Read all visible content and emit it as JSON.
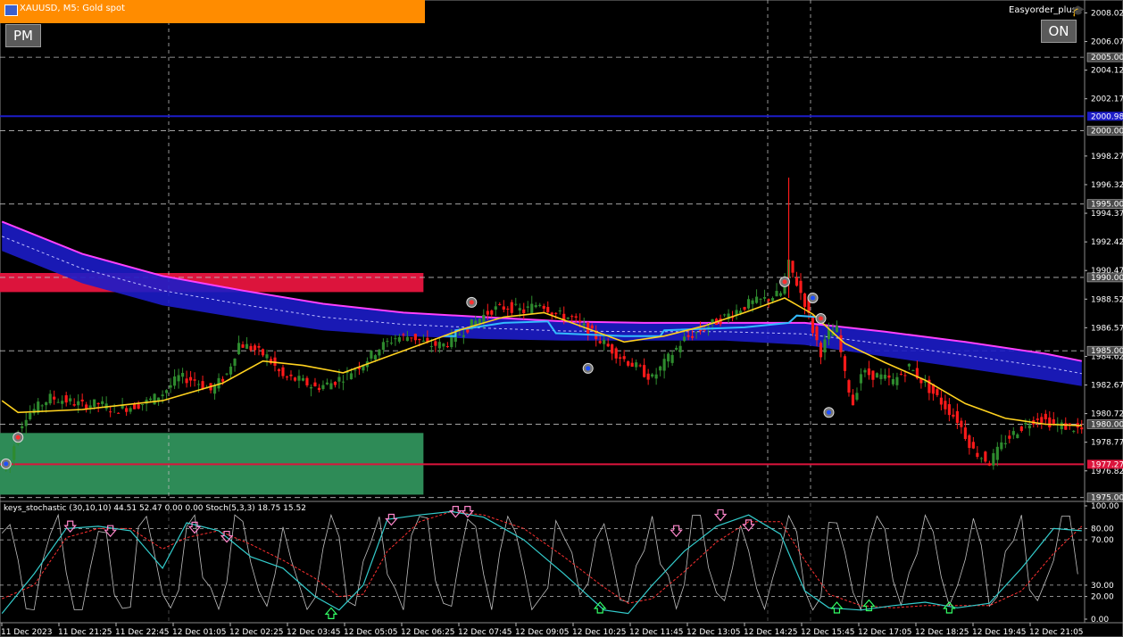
{
  "header": {
    "symbol_label": "XAUUSD, M5:  Gold spot"
  },
  "buttons": {
    "pm": "PM",
    "on": "ON"
  },
  "expert": {
    "name": "Easyorder_plus",
    "icon": "graduation-cap-icon"
  },
  "indicator": {
    "label": "keys_stochastic (30,10,10) 44.51 52.47 0.00 0.00 Stoch(5,3,3) 18.75 15.52"
  },
  "colors": {
    "background": "#000000",
    "bull": "#2e8b2e",
    "bear": "#ff1a1a",
    "ma_yellow": "#ffd21f",
    "band_magenta": "#ff40ff",
    "band_blue": "#1c1cc8",
    "band_cyan": "#33bbff",
    "resistance_zone": "#dc143c",
    "support_zone": "#2e8b57",
    "header": "#ff8c00",
    "stoch_main": "#33cccc",
    "stoch_signal": "#ff3030",
    "stoch_fast": "#bfbfbf"
  },
  "chart_data": [
    {
      "type": "candlestick",
      "title": "XAUUSD, M5:  Gold spot",
      "y_tick_labels": [
        "2008.02",
        "2006.07",
        "2004.12",
        "2002.17",
        "1998.27",
        "1996.32",
        "1994.37",
        "1992.42",
        "1990.47",
        "1988.52",
        "1986.57",
        "1984.62",
        "1982.67",
        "1980.72",
        "1978.77",
        "1976.82"
      ],
      "y_tick_values": [
        2008.02,
        2006.07,
        2004.12,
        2002.17,
        1998.27,
        1996.32,
        1994.37,
        1992.42,
        1990.47,
        1988.52,
        1986.57,
        1984.62,
        1982.67,
        1980.72,
        1978.77,
        1976.82
      ],
      "boxed_levels": [
        {
          "label": "2005.00",
          "value": 2005.0
        },
        {
          "label": "2000.00",
          "value": 2000.0
        },
        {
          "label": "1995.00",
          "value": 1995.0
        },
        {
          "label": "1990.00",
          "value": 1990.0
        },
        {
          "label": "1985.00",
          "value": 1985.0
        },
        {
          "label": "1980.00",
          "value": 1980.0
        },
        {
          "label": "1975.00",
          "value": 1975.0
        }
      ],
      "horizontal_lines": [
        {
          "label": "2000.98",
          "value": 2000.98,
          "color": "#1c1cc8"
        },
        {
          "label": "1977.27",
          "value": 1977.27,
          "color": "#dc143c"
        }
      ],
      "ylim": [
        1974.8,
        2008.9
      ],
      "x_tick_labels": [
        "11 Dec 2023",
        "11 Dec 21:25",
        "11 Dec 22:45",
        "12 Dec 01:05",
        "12 Dec 02:25",
        "12 Dec 03:45",
        "12 Dec 05:05",
        "12 Dec 06:25",
        "12 Dec 07:45",
        "12 Dec 09:05",
        "12 Dec 10:25",
        "12 Dec 11:45",
        "12 Dec 13:05",
        "12 Dec 14:25",
        "12 Dec 15:45",
        "12 Dec 17:05",
        "12 Dec 18:25",
        "12 Dec 19:45",
        "12 Dec 21:05"
      ],
      "close_path": [
        [
          0,
          1976.9
        ],
        [
          2,
          1977.5
        ],
        [
          4,
          1979.6
        ],
        [
          6,
          1980.6
        ],
        [
          8,
          1981.0
        ],
        [
          12,
          1981.8
        ],
        [
          16,
          1981.6
        ],
        [
          20,
          1981.3
        ],
        [
          24,
          1981.4
        ],
        [
          28,
          1981.0
        ],
        [
          32,
          1981.2
        ],
        [
          36,
          1981.5
        ],
        [
          40,
          1982.1
        ],
        [
          44,
          1983.2
        ],
        [
          48,
          1983.0
        ],
        [
          52,
          1982.3
        ],
        [
          56,
          1983.4
        ],
        [
          59,
          1985.5
        ],
        [
          62,
          1985.2
        ],
        [
          66,
          1984.6
        ],
        [
          70,
          1983.2
        ],
        [
          74,
          1983.0
        ],
        [
          78,
          1982.5
        ],
        [
          82,
          1982.8
        ],
        [
          86,
          1983.4
        ],
        [
          90,
          1984.2
        ],
        [
          94,
          1985.2
        ],
        [
          98,
          1985.9
        ],
        [
          102,
          1986.0
        ],
        [
          106,
          1985.4
        ],
        [
          110,
          1985.4
        ],
        [
          114,
          1986.2
        ],
        [
          118,
          1987.0
        ],
        [
          122,
          1987.8
        ],
        [
          126,
          1988.0
        ],
        [
          130,
          1987.7
        ],
        [
          134,
          1988.3
        ],
        [
          138,
          1987.5
        ],
        [
          142,
          1987.2
        ],
        [
          146,
          1986.4
        ],
        [
          150,
          1985.5
        ],
        [
          154,
          1984.6
        ],
        [
          158,
          1983.9
        ],
        [
          162,
          1983.1
        ],
        [
          166,
          1984.5
        ],
        [
          170,
          1985.8
        ],
        [
          174,
          1986.4
        ],
        [
          178,
          1987.0
        ],
        [
          182,
          1987.6
        ],
        [
          186,
          1988.2
        ],
        [
          190,
          1988.5
        ],
        [
          194,
          1988.9
        ],
        [
          196,
          1990.9
        ],
        [
          198,
          1989.6
        ],
        [
          200,
          1988.3
        ],
        [
          202,
          1986.4
        ],
        [
          204,
          1984.9
        ],
        [
          206,
          1986.2
        ],
        [
          208,
          1986.4
        ],
        [
          210,
          1983.3
        ],
        [
          212,
          1981.4
        ],
        [
          214,
          1983.5
        ],
        [
          218,
          1983.3
        ],
        [
          222,
          1982.9
        ],
        [
          226,
          1983.9
        ],
        [
          230,
          1982.7
        ],
        [
          234,
          1981.5
        ],
        [
          238,
          1980.3
        ],
        [
          242,
          1978.2
        ],
        [
          246,
          1977.4
        ],
        [
          250,
          1978.9
        ],
        [
          254,
          1979.8
        ],
        [
          258,
          1980.5
        ],
        [
          262,
          1980.0
        ],
        [
          266,
          1979.8
        ],
        [
          269,
          1979.6
        ]
      ],
      "spike": {
        "bar": 196,
        "high": 1996.8
      },
      "bands": {
        "upper": [
          [
            0,
            1993.8
          ],
          [
            20,
            1991.6
          ],
          [
            40,
            1990.1
          ],
          [
            60,
            1989.1
          ],
          [
            80,
            1988.2
          ],
          [
            100,
            1987.6
          ],
          [
            120,
            1987.3
          ],
          [
            140,
            1987.0
          ],
          [
            160,
            1986.9
          ],
          [
            180,
            1986.9
          ],
          [
            200,
            1986.9
          ],
          [
            220,
            1986.3
          ],
          [
            240,
            1985.6
          ],
          [
            260,
            1984.8
          ],
          [
            269,
            1984.3
          ]
        ],
        "lower": [
          [
            0,
            1991.8
          ],
          [
            20,
            1989.6
          ],
          [
            40,
            1988.1
          ],
          [
            60,
            1987.2
          ],
          [
            80,
            1986.4
          ],
          [
            100,
            1986.0
          ],
          [
            120,
            1985.8
          ],
          [
            140,
            1985.7
          ],
          [
            160,
            1985.7
          ],
          [
            180,
            1985.7
          ],
          [
            200,
            1985.4
          ],
          [
            220,
            1984.6
          ],
          [
            240,
            1983.8
          ],
          [
            260,
            1983.0
          ],
          [
            269,
            1982.6
          ]
        ]
      },
      "cyan_step": [
        [
          110,
          1986.0
        ],
        [
          113,
          1986.0
        ],
        [
          113,
          1986.4
        ],
        [
          125,
          1986.9
        ],
        [
          136,
          1987.0
        ],
        [
          138,
          1986.2
        ],
        [
          155,
          1986.0
        ],
        [
          164,
          1986.0
        ],
        [
          165,
          1986.4
        ],
        [
          185,
          1986.6
        ],
        [
          196,
          1986.9
        ],
        [
          198,
          1987.4
        ],
        [
          203,
          1987.3
        ]
      ],
      "moving_average": [
        [
          0,
          1981.6
        ],
        [
          4,
          1980.8
        ],
        [
          20,
          1981.0
        ],
        [
          40,
          1981.6
        ],
        [
          55,
          1982.8
        ],
        [
          65,
          1984.3
        ],
        [
          75,
          1984.0
        ],
        [
          85,
          1983.5
        ],
        [
          95,
          1984.5
        ],
        [
          105,
          1985.5
        ],
        [
          115,
          1986.5
        ],
        [
          125,
          1987.3
        ],
        [
          135,
          1987.6
        ],
        [
          145,
          1986.6
        ],
        [
          155,
          1985.6
        ],
        [
          165,
          1986.0
        ],
        [
          175,
          1986.7
        ],
        [
          185,
          1987.6
        ],
        [
          195,
          1988.6
        ],
        [
          202,
          1987.5
        ],
        [
          210,
          1985.5
        ],
        [
          220,
          1984.2
        ],
        [
          230,
          1983.0
        ],
        [
          240,
          1981.4
        ],
        [
          250,
          1980.4
        ],
        [
          260,
          1980.0
        ],
        [
          269,
          1979.9
        ]
      ],
      "trade_markers": [
        {
          "bar": 1,
          "value": 1977.3,
          "kind": "buy"
        },
        {
          "bar": 4,
          "value": 1979.1,
          "kind": "sell"
        },
        {
          "bar": 117,
          "value": 1988.3,
          "kind": "sell"
        },
        {
          "bar": 146,
          "value": 1983.8,
          "kind": "buy"
        },
        {
          "bar": 195,
          "value": 1989.7,
          "kind": "sell"
        },
        {
          "bar": 202,
          "value": 1988.6,
          "kind": "buy"
        },
        {
          "bar": 204,
          "value": 1987.2,
          "kind": "sell"
        },
        {
          "bar": 206,
          "value": 1980.8,
          "kind": "buy"
        }
      ],
      "zones": [
        {
          "label": "resistance",
          "from": 1989.0,
          "to": 1990.3,
          "x_to": 105
        },
        {
          "label": "support",
          "from": 1975.2,
          "to": 1979.4,
          "x_to": 105
        }
      ]
    },
    {
      "type": "line",
      "title": "keys_stochastic (30,10,10) 44.51 52.47 0.00 0.00 Stoch(5,3,3) 18.75 15.52",
      "y_tick_labels": [
        "100.00",
        "80.00",
        "70.00",
        "30.00",
        "20.00",
        "0.00"
      ],
      "y_tick_values": [
        100,
        80,
        70,
        30,
        20,
        0
      ],
      "ylim": [
        0,
        100
      ],
      "series": [
        {
          "name": "keys_stochastic",
          "values": [
            [
              0,
              5
            ],
            [
              8,
              40
            ],
            [
              16,
              80
            ],
            [
              24,
              82
            ],
            [
              32,
              78
            ],
            [
              40,
              45
            ],
            [
              46,
              85
            ],
            [
              54,
              78
            ],
            [
              62,
              55
            ],
            [
              70,
              45
            ],
            [
              78,
              20
            ],
            [
              84,
              8
            ],
            [
              90,
              30
            ],
            [
              96,
              88
            ],
            [
              104,
              92
            ],
            [
              112,
              95
            ],
            [
              120,
              90
            ],
            [
              130,
              70
            ],
            [
              140,
              40
            ],
            [
              150,
              8
            ],
            [
              156,
              5
            ],
            [
              162,
              30
            ],
            [
              170,
              60
            ],
            [
              178,
              82
            ],
            [
              186,
              92
            ],
            [
              194,
              75
            ],
            [
              200,
              25
            ],
            [
              206,
              10
            ],
            [
              214,
              8
            ],
            [
              222,
              12
            ],
            [
              230,
              15
            ],
            [
              238,
              10
            ],
            [
              246,
              14
            ],
            [
              254,
              45
            ],
            [
              262,
              80
            ],
            [
              269,
              78
            ]
          ]
        },
        {
          "name": "signal",
          "values": [
            [
              0,
              18
            ],
            [
              8,
              30
            ],
            [
              16,
              72
            ],
            [
              24,
              80
            ],
            [
              32,
              80
            ],
            [
              40,
              62
            ],
            [
              46,
              72
            ],
            [
              54,
              78
            ],
            [
              62,
              66
            ],
            [
              70,
              52
            ],
            [
              78,
              36
            ],
            [
              84,
              20
            ],
            [
              90,
              22
            ],
            [
              96,
              60
            ],
            [
              104,
              86
            ],
            [
              112,
              95
            ],
            [
              120,
              92
            ],
            [
              130,
              80
            ],
            [
              140,
              55
            ],
            [
              150,
              28
            ],
            [
              156,
              14
            ],
            [
              162,
              18
            ],
            [
              170,
              42
            ],
            [
              178,
              68
            ],
            [
              186,
              86
            ],
            [
              194,
              86
            ],
            [
              200,
              52
            ],
            [
              206,
              22
            ],
            [
              214,
              12
            ],
            [
              222,
              10
            ],
            [
              230,
              12
            ],
            [
              238,
              12
            ],
            [
              246,
              12
            ],
            [
              254,
              25
            ],
            [
              262,
              58
            ],
            [
              269,
              82
            ]
          ]
        }
      ],
      "arrows": [
        {
          "bar": 17,
          "value": 81,
          "dir": "down"
        },
        {
          "bar": 27,
          "value": 77,
          "dir": "down"
        },
        {
          "bar": 48,
          "value": 80,
          "dir": "down"
        },
        {
          "bar": 56,
          "value": 72,
          "dir": "down"
        },
        {
          "bar": 97,
          "value": 87,
          "dir": "down"
        },
        {
          "bar": 113,
          "value": 94,
          "dir": "down"
        },
        {
          "bar": 116,
          "value": 94,
          "dir": "down"
        },
        {
          "bar": 168,
          "value": 77,
          "dir": "down"
        },
        {
          "bar": 179,
          "value": 91,
          "dir": "down"
        },
        {
          "bar": 186,
          "value": 82,
          "dir": "down"
        },
        {
          "bar": 82,
          "value": 6,
          "dir": "up"
        },
        {
          "bar": 149,
          "value": 11,
          "dir": "up"
        },
        {
          "bar": 208,
          "value": 11,
          "dir": "up"
        },
        {
          "bar": 216,
          "value": 13,
          "dir": "up"
        },
        {
          "bar": 236,
          "value": 11,
          "dir": "up"
        }
      ]
    }
  ]
}
